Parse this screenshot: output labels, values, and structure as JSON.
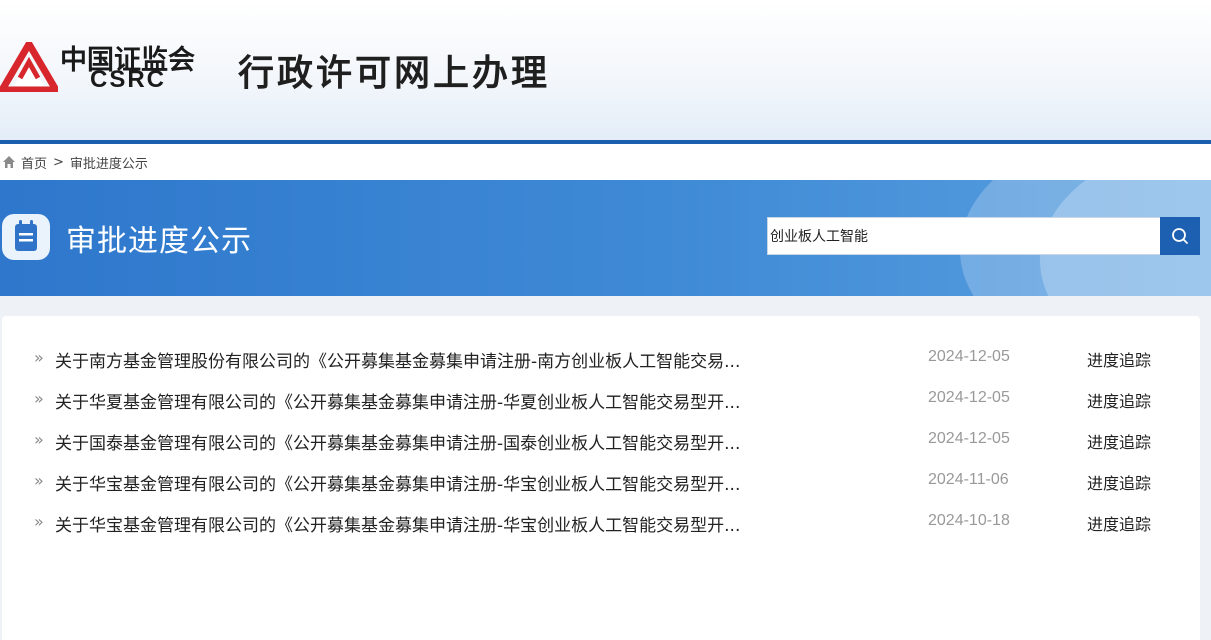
{
  "header": {
    "logo_cn": "中国证监会",
    "logo_en": "CSRC",
    "site_title": "行政许可网上办理"
  },
  "breadcrumb": {
    "home": "首页",
    "separator": ">",
    "current": "审批进度公示"
  },
  "banner": {
    "title": "审批进度公示"
  },
  "search": {
    "value": "创业板人工智能",
    "placeholder": ""
  },
  "colors": {
    "brand_blue": "#1a5fae",
    "banner_blue": "#3f8ad6",
    "logo_red": "#d7262c"
  },
  "results": [
    {
      "title": "关于南方基金管理股份有限公司的《公开募集基金募集申请注册-南方创业板人工智能交易...",
      "date": "2024-12-05",
      "action": "进度追踪"
    },
    {
      "title": "关于华夏基金管理有限公司的《公开募集基金募集申请注册-华夏创业板人工智能交易型开...",
      "date": "2024-12-05",
      "action": "进度追踪"
    },
    {
      "title": "关于国泰基金管理有限公司的《公开募集基金募集申请注册-国泰创业板人工智能交易型开...",
      "date": "2024-12-05",
      "action": "进度追踪"
    },
    {
      "title": "关于华宝基金管理有限公司的《公开募集基金募集申请注册-华宝创业板人工智能交易型开...",
      "date": "2024-11-06",
      "action": "进度追踪"
    },
    {
      "title": "关于华宝基金管理有限公司的《公开募集基金募集申请注册-华宝创业板人工智能交易型开...",
      "date": "2024-10-18",
      "action": "进度追踪"
    }
  ]
}
